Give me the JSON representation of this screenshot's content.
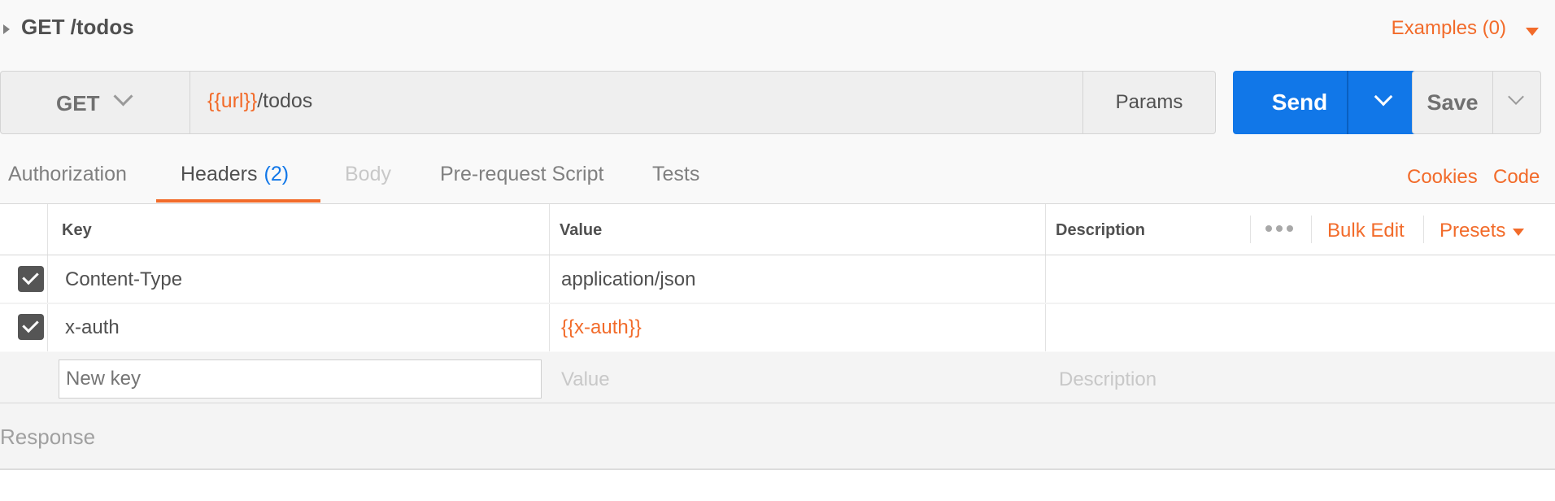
{
  "request": {
    "title": "GET /todos",
    "examples_label": "Examples (0)",
    "method": "GET",
    "url_var": "{{url}}",
    "url_path": "/todos",
    "params_label": "Params",
    "send_label": "Send",
    "save_label": "Save"
  },
  "tabs": {
    "authorization": "Authorization",
    "headers": "Headers",
    "headers_count": "(2)",
    "body": "Body",
    "prerequest": "Pre-request Script",
    "tests": "Tests",
    "cookies": "Cookies",
    "code": "Code"
  },
  "table": {
    "columns": {
      "key": "Key",
      "value": "Value",
      "description": "Description"
    },
    "bulk_edit": "Bulk Edit",
    "presets": "Presets",
    "rows": [
      {
        "checked": true,
        "key": "Content-Type",
        "value": "application/json",
        "description": ""
      },
      {
        "checked": true,
        "key": "x-auth",
        "value": "{{x-auth}}",
        "description": ""
      }
    ],
    "new_row": {
      "key_placeholder": "New key",
      "value_placeholder": "Value",
      "description_placeholder": "Description"
    }
  },
  "response": {
    "label": "Response"
  },
  "colors": {
    "accent": "#f26b2a",
    "primary": "#1177e8"
  }
}
